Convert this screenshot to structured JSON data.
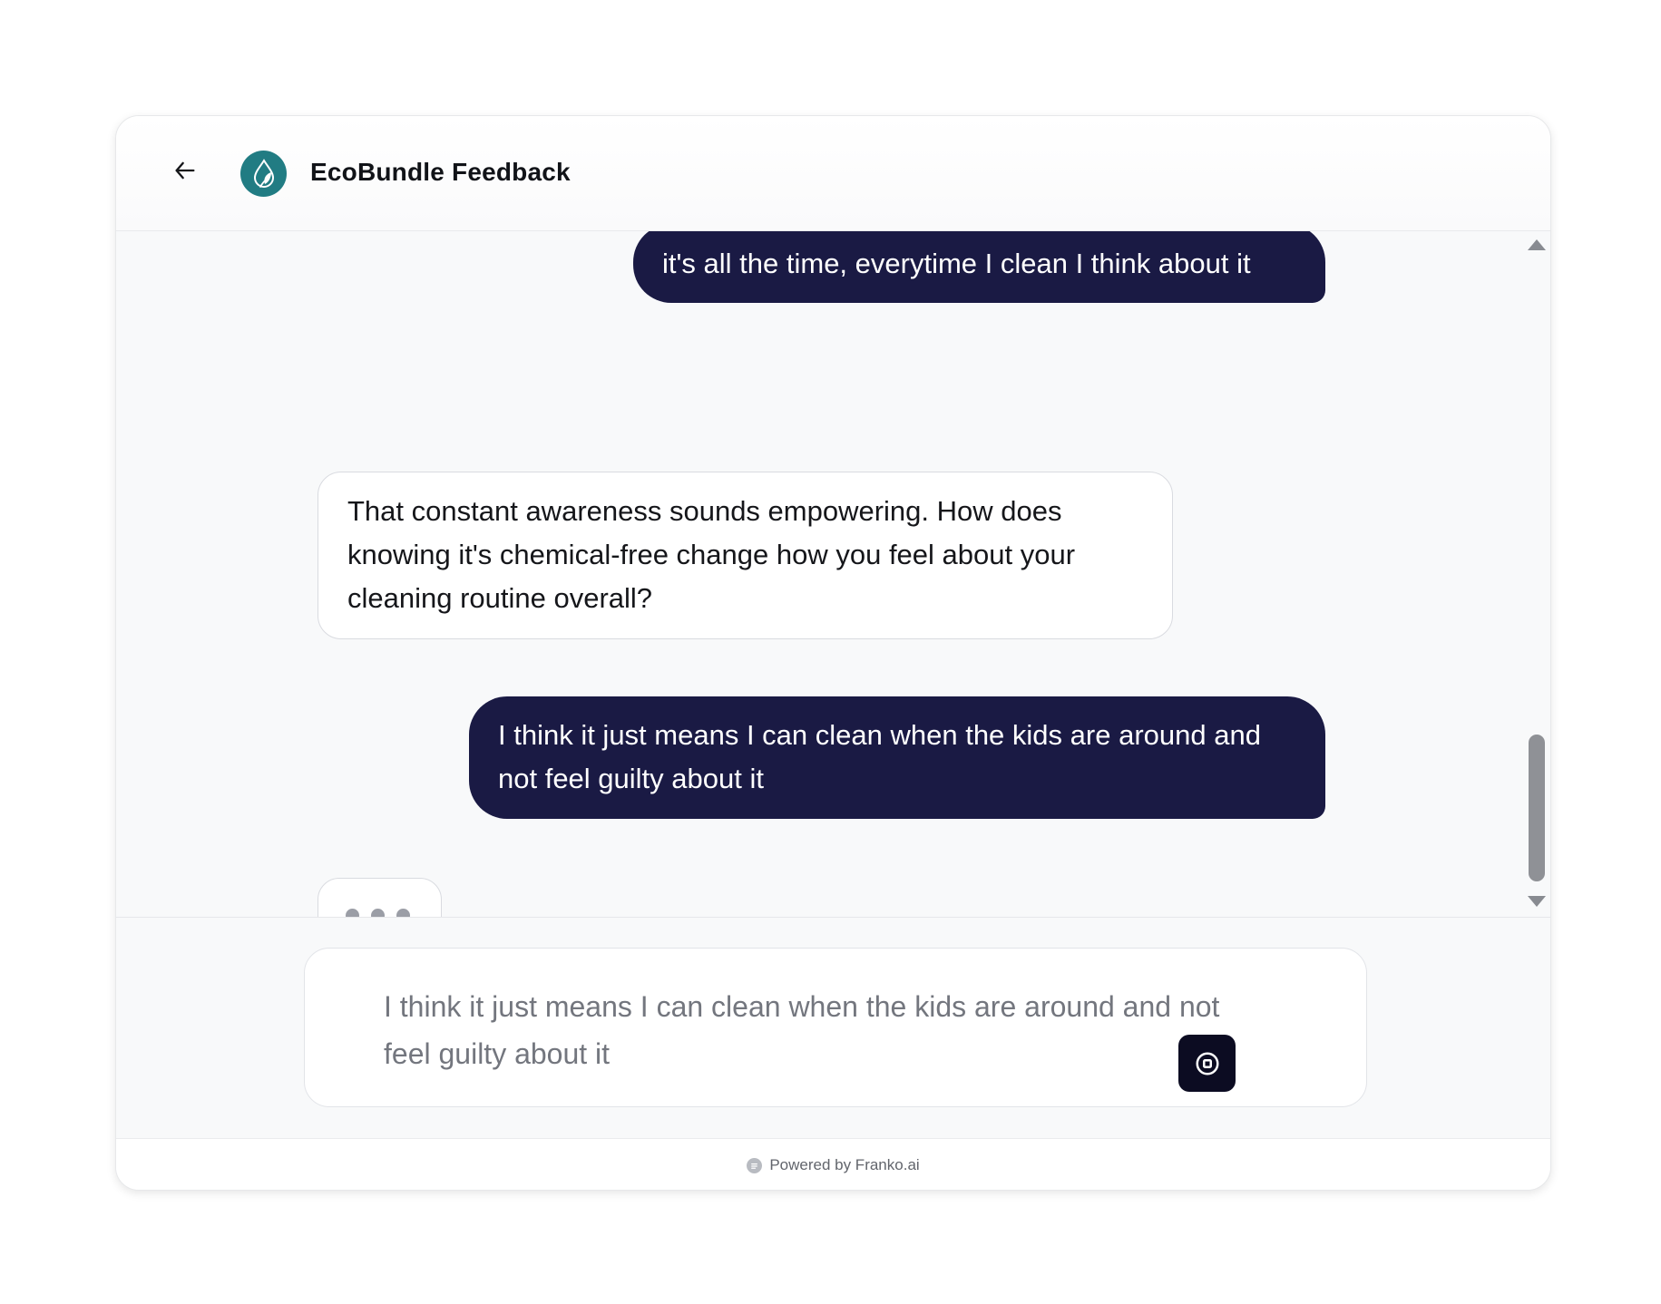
{
  "header": {
    "back_icon": "arrow-left-icon",
    "avatar_icon": "water-drop-leaf-icon",
    "avatar_color": "#217c83",
    "title": "EcoBundle Feedback"
  },
  "messages": [
    {
      "role": "user",
      "text": "it's all the time, everytime I clean I think about it"
    },
    {
      "role": "assistant",
      "text": "That constant awareness sounds empowering. How does knowing it's chemical-free change how you feel about your cleaning routine overall?"
    },
    {
      "role": "user",
      "text": "I think it just means I can clean when the kids are around and not feel guilty about it"
    }
  ],
  "typing_indicator": {
    "visible": true,
    "dots": 3
  },
  "composer": {
    "value": "I think it just means I can clean when the kids are around and not feel guilty about it",
    "stop_icon": "stop-circle-icon"
  },
  "footer": {
    "icon": "chat-bubble-icon",
    "text": "Powered by Franko.ai"
  },
  "colors": {
    "user_bubble": "#1a1a44",
    "stop_button": "#0c0c22"
  }
}
